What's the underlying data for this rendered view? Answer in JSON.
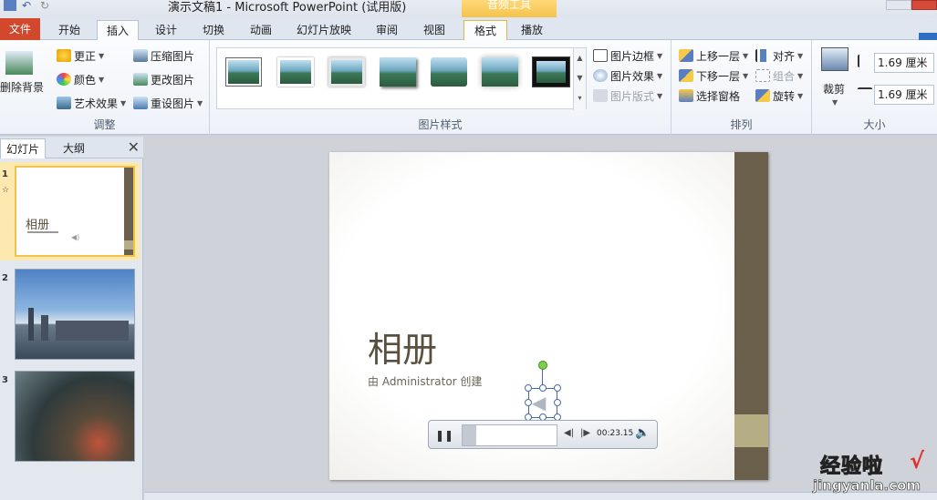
{
  "window": {
    "title": "演示文稿1 - Microsoft PowerPoint (试用版)",
    "context_tab": "音频工具"
  },
  "tabs": [
    {
      "label": "文件"
    },
    {
      "label": "开始"
    },
    {
      "label": "插入"
    },
    {
      "label": "设计"
    },
    {
      "label": "切换"
    },
    {
      "label": "动画"
    },
    {
      "label": "幻灯片放映"
    },
    {
      "label": "审阅"
    },
    {
      "label": "视图"
    },
    {
      "label": "格式"
    },
    {
      "label": "播放"
    }
  ],
  "ribbon": {
    "adjust": {
      "remove_bg": "删除背景",
      "corrections": "更正",
      "color": "颜色",
      "artistic": "艺术效果",
      "compress": "压缩图片",
      "change": "更改图片",
      "reset": "重设图片",
      "label": "调整"
    },
    "picture_styles": {
      "border": "图片边框",
      "effects": "图片效果",
      "layout": "图片版式",
      "label": "图片样式"
    },
    "arrange": {
      "bring_forward": "上移一层",
      "send_backward": "下移一层",
      "selection_pane": "选择窗格",
      "align": "对齐",
      "group": "组合",
      "rotate": "旋转",
      "label": "排列"
    },
    "size": {
      "crop": "裁剪",
      "height": "1.69 厘米",
      "width": "1.69 厘米",
      "label": "大小"
    }
  },
  "left_pane": {
    "tab_slides": "幻灯片",
    "tab_outline": "大纲",
    "close": "✕",
    "slides": [
      {
        "number": "1",
        "title": "相册"
      },
      {
        "number": "2"
      },
      {
        "number": "3"
      }
    ]
  },
  "slide": {
    "title": "相册",
    "subtitle": "由 Administrator 创建"
  },
  "player": {
    "time": "00:23.15",
    "progress": 0.15
  },
  "watermark": {
    "title": "经验啦",
    "url": "jingyanla.com"
  },
  "colors": {
    "file_tab": "#d2482c",
    "context_tab": "#f4c34c",
    "slide_band": "#6a5f4b",
    "slide_band_accent": "#b5ad84"
  }
}
